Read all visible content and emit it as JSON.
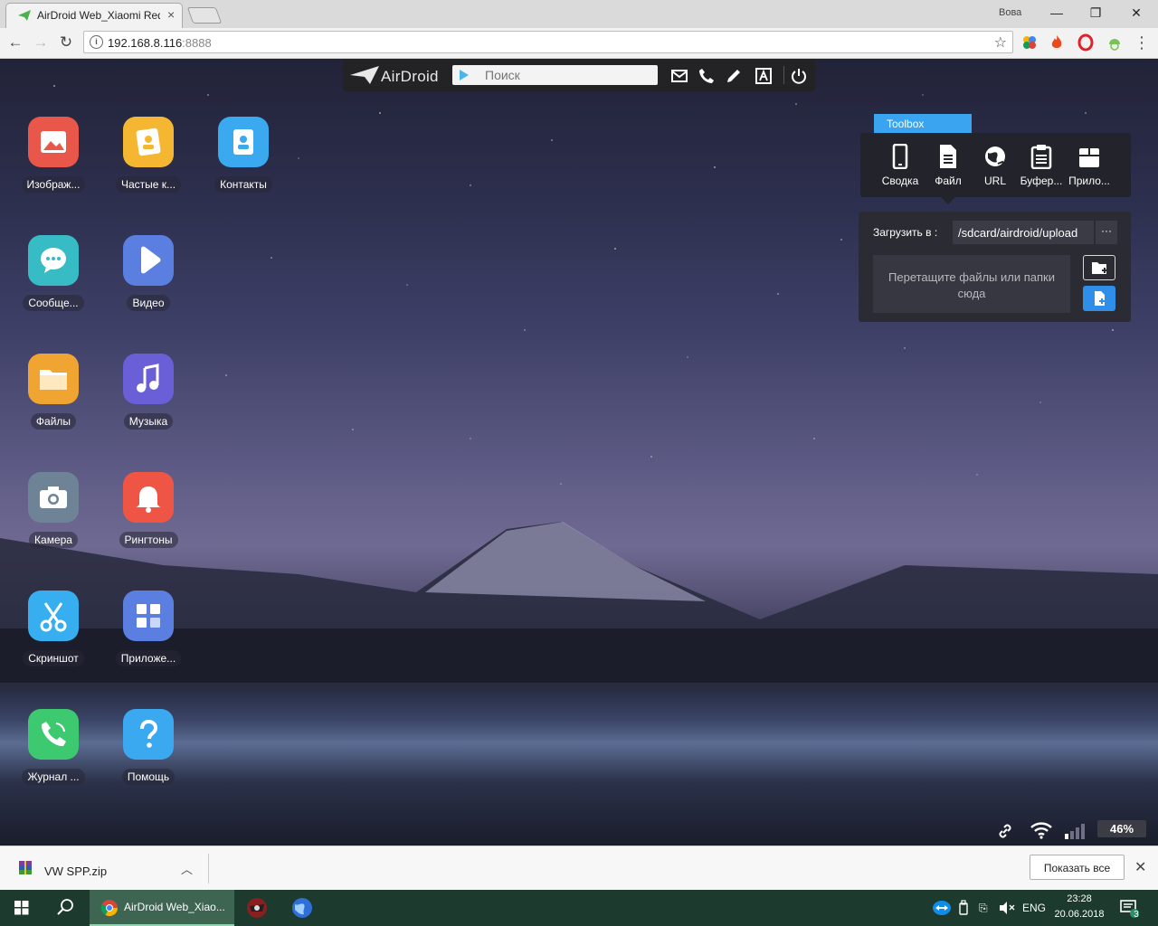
{
  "browser": {
    "tab_title": "AirDroid Web_Xiaomi Red",
    "user_name": "Вова",
    "minimize": "—",
    "restore": "❐",
    "close": "✕",
    "url_host": "192.168.8.116",
    "url_port": ":8888"
  },
  "topbar": {
    "logo_text": "AirDroid",
    "search_placeholder": "Поиск"
  },
  "apps": [
    {
      "label": "Изображ...",
      "color": "#e8574a",
      "icon": "image-icon"
    },
    {
      "label": "Частые к...",
      "color": "#f5b731",
      "icon": "contacts-card-icon"
    },
    {
      "label": "Контакты",
      "color": "#3aa9f0",
      "icon": "contact-book-icon"
    },
    {
      "label": "Сообще...",
      "color": "#37bcc6",
      "icon": "message-bubble-icon"
    },
    {
      "label": "Видео",
      "color": "#5a7fe0",
      "icon": "play-icon"
    },
    {
      "label": "Файлы",
      "color": "#f0a431",
      "icon": "folder-icon"
    },
    {
      "label": "Музыка",
      "color": "#6a5fd6",
      "icon": "music-note-icon"
    },
    {
      "label": "Камера",
      "color": "#6f8396",
      "icon": "camera-icon"
    },
    {
      "label": "Рингтоны",
      "color": "#ee5544",
      "icon": "bell-icon"
    },
    {
      "label": "Скриншот",
      "color": "#36aef0",
      "icon": "scissors-icon"
    },
    {
      "label": "Приложе...",
      "color": "#5a7fe0",
      "icon": "apps-grid-icon"
    },
    {
      "label": "Журнал ...",
      "color": "#3dc96f",
      "icon": "phone-icon"
    },
    {
      "label": "Помощь",
      "color": "#3aa9f0",
      "icon": "question-icon"
    }
  ],
  "toolbox": {
    "title": "Toolbox",
    "items": [
      {
        "label": "Сводка",
        "icon": "phone-device-icon"
      },
      {
        "label": "Файл",
        "icon": "file-icon"
      },
      {
        "label": "URL",
        "icon": "globe-icon"
      },
      {
        "label": "Буфер...",
        "icon": "clipboard-icon"
      },
      {
        "label": "Прило...",
        "icon": "app-box-icon"
      }
    ]
  },
  "upload": {
    "label": "Загрузить в :",
    "path": "/sdcard/airdroid/upload",
    "more": "···",
    "dropzone_text": "Перетащите файлы или папки сюда"
  },
  "status": {
    "battery": "46%"
  },
  "download_bar": {
    "file_name": "VW SPP.zip",
    "show_all": "Показать все",
    "close": "✕"
  },
  "taskbar": {
    "task_label": "AirDroid Web_Xiao...",
    "language": "ENG",
    "time": "23:28",
    "date": "20.06.2018",
    "notifications": "3"
  }
}
